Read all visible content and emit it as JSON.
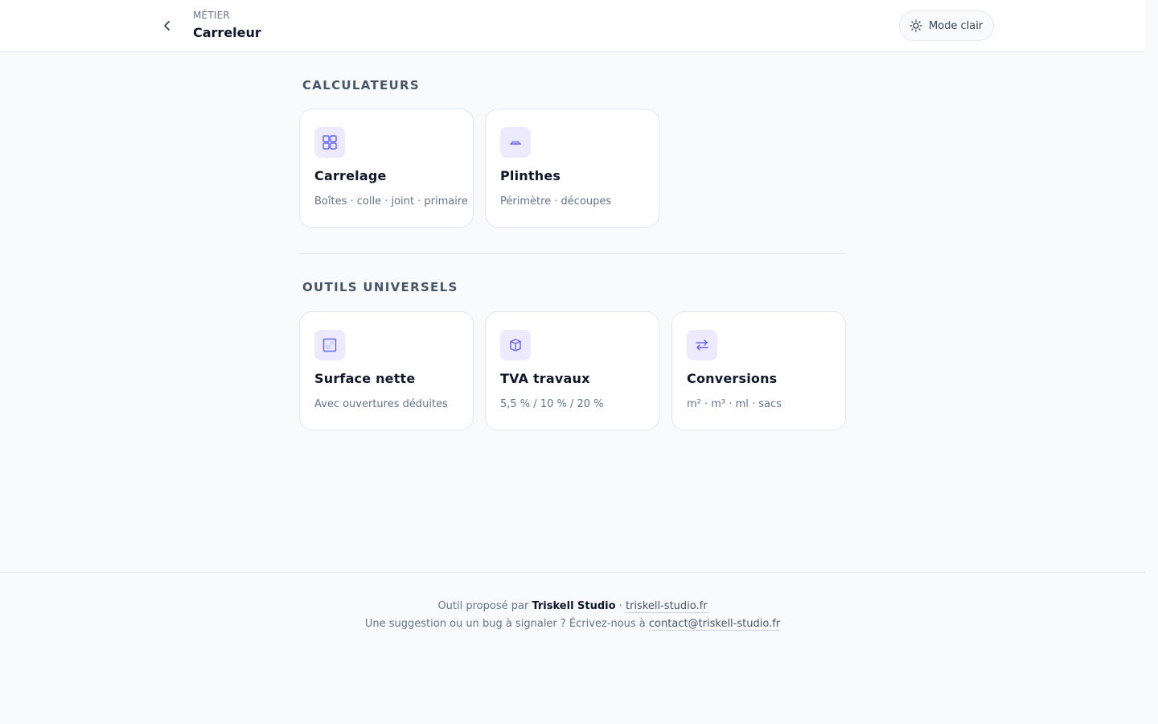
{
  "header": {
    "eyebrow": "MÉTIER",
    "title": "Carreleur",
    "theme_toggle_label": "Mode clair"
  },
  "sections": {
    "calculators": {
      "title": "CALCULATEURS",
      "cards": [
        {
          "title": "Carrelage",
          "subtitle": "Boîtes · colle · joint · primaire",
          "icon": "tiles-grid-icon"
        },
        {
          "title": "Plinthes",
          "subtitle": "Périmètre · découpes",
          "icon": "baseboard-icon"
        }
      ]
    },
    "universal_tools": {
      "title": "OUTILS UNIVERSELS",
      "cards": [
        {
          "title": "Surface nette",
          "subtitle": "Avec ouvertures déduites",
          "icon": "surface-icon"
        },
        {
          "title": "TVA travaux",
          "subtitle": "5,5 % / 10 % / 20 %",
          "icon": "box-3d-icon"
        },
        {
          "title": "Conversions",
          "subtitle": "m² · m³ · ml · sacs",
          "icon": "swap-arrows-icon"
        }
      ]
    }
  },
  "footer": {
    "line1_prefix": "Outil proposé par",
    "line1_brand": "Triskell Studio",
    "line1_separator": "·",
    "line1_link": "triskell-studio.fr",
    "line2_prefix": "Une suggestion ou un bug à signaler ? Écrivez-nous à",
    "line2_link": "contact@triskell-studio.fr"
  },
  "colors": {
    "accent": "#6366f1",
    "icon_bg": "#ede9fe",
    "background": "#f8fafc",
    "border": "#e2e8f0"
  }
}
